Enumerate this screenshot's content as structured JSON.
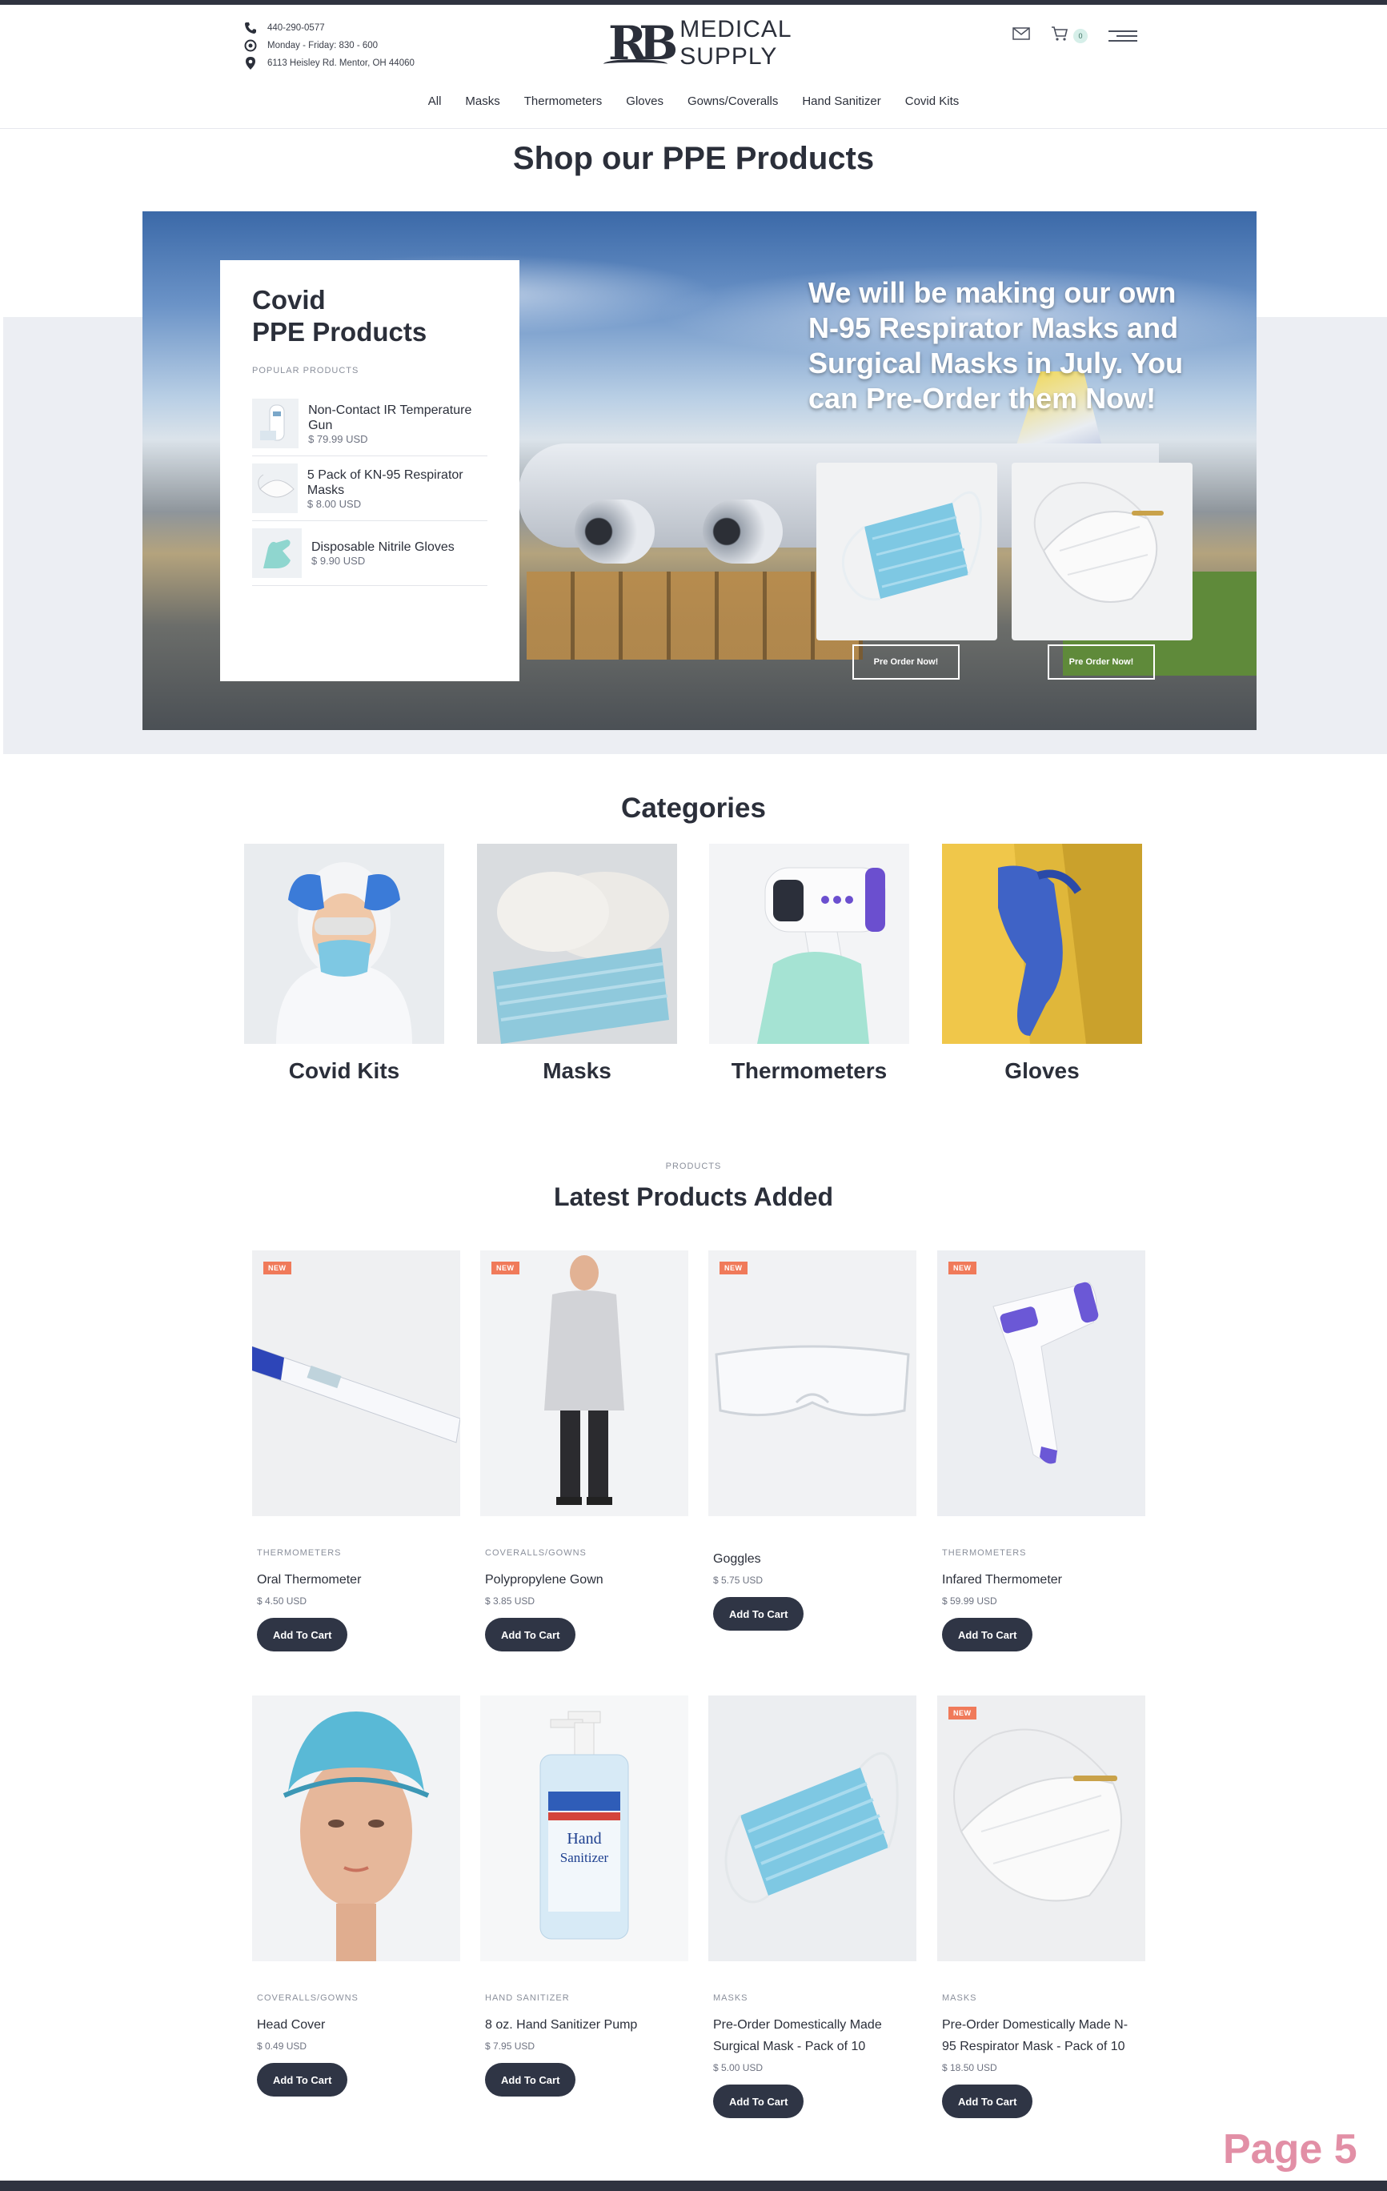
{
  "header": {
    "phone": "440-290-0577",
    "hours": "Monday - Friday: 830 - 600",
    "address": "6113 Heisley Rd. Mentor, OH 44060",
    "logo_mark": "RB",
    "logo_line1": "MEDICAL",
    "logo_line2": "SUPPLY",
    "cart_count": "0"
  },
  "nav": [
    "All",
    "Masks",
    "Thermometers",
    "Gloves",
    "Gowns/Coveralls",
    "Hand Sanitizer",
    "Covid Kits"
  ],
  "page_title": "Shop our PPE Products",
  "hero": {
    "card_title_line1": "Covid",
    "card_title_line2": "PPE Products",
    "card_kicker": "POPULAR PRODUCTS",
    "popular": [
      {
        "name": "Non-Contact IR Temperature Gun",
        "price": "$ 79.99 USD"
      },
      {
        "name": "5 Pack of KN-95 Respirator Masks",
        "price": "$ 8.00 USD"
      },
      {
        "name": "Disposable Nitrile Gloves",
        "price": "$ 9.90 USD"
      }
    ],
    "headline": "We will be making our own N-95 Respirator Masks and Surgical Masks in July. You can Pre-Order them Now!",
    "preorder_label": "Pre Order Now!"
  },
  "categories": {
    "title": "Categories",
    "items": [
      "Covid Kits",
      "Masks",
      "Thermometers",
      "Gloves"
    ]
  },
  "latest": {
    "kicker": "PRODUCTS",
    "title": "Latest Products Added",
    "add_label": "Add To Cart",
    "new_label": "NEW",
    "products": [
      {
        "category": "THERMOMETERS",
        "name": "Oral Thermometer",
        "price": "$ 4.50 USD",
        "new": true
      },
      {
        "category": "COVERALLS/GOWNS",
        "name": "Polypropylene Gown",
        "price": "$ 3.85 USD",
        "new": true
      },
      {
        "category": "",
        "name": "Goggles",
        "price": "$ 5.75 USD",
        "new": true
      },
      {
        "category": "THERMOMETERS",
        "name": "Infared Thermometer",
        "price": "$ 59.99 USD",
        "new": true
      },
      {
        "category": "COVERALLS/GOWNS",
        "name": "Head Cover",
        "price": "$ 0.49 USD",
        "new": false
      },
      {
        "category": "HAND SANITIZER",
        "name": "8 oz. Hand Sanitizer Pump",
        "price": "$ 7.95 USD",
        "new": false
      },
      {
        "category": "MASKS",
        "name": "Pre-Order Domestically Made Surgical Mask - Pack of 10",
        "price": "$ 5.00 USD",
        "new": false
      },
      {
        "category": "MASKS",
        "name": "Pre-Order Domestically Made N-95 Respirator Mask - Pack of 10",
        "price": "$ 18.50 USD",
        "new": true
      }
    ]
  },
  "page_label": "Page 5",
  "colors": {
    "dark": "#2f3545",
    "badge": "#f07a5a",
    "band": "#eceef3",
    "page_mark": "#e28fa6"
  }
}
